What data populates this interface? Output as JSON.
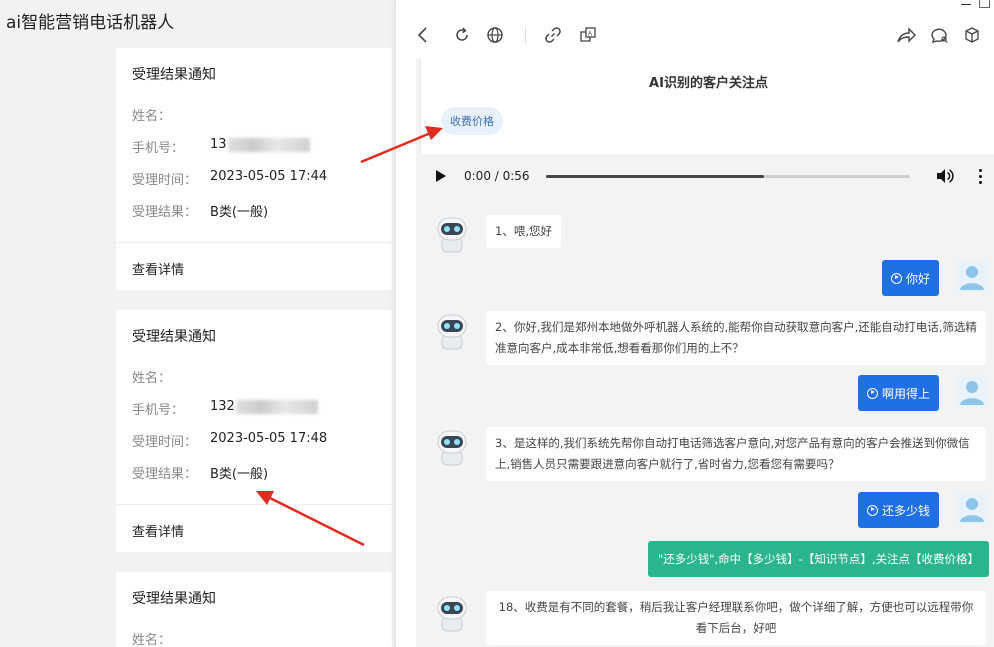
{
  "app": {
    "title": "ai智能营销电话机器人"
  },
  "cards": [
    {
      "title": "受理结果通知",
      "name_label": "姓名：",
      "name_value": "",
      "phone_label": "手机号：",
      "phone_value": "13",
      "time_label": "受理时间：",
      "time_value": "2023-05-05 17:44",
      "result_label": "受理结果：",
      "result_value": "B类(一般)",
      "detail": "查看详情"
    },
    {
      "title": "受理结果通知",
      "name_label": "姓名：",
      "name_value": "",
      "phone_label": "手机号：",
      "phone_value": "132",
      "time_label": "受理时间：",
      "time_value": "2023-05-05 17:48",
      "result_label": "受理结果：",
      "result_value": "B类(一般)",
      "detail": "查看详情"
    },
    {
      "title": "受理结果通知",
      "name_label": "姓名："
    }
  ],
  "panel": {
    "focus_title": "AI识别的客户关注点",
    "tags": [
      "收费价格"
    ],
    "audio": {
      "time": "0:00 / 0:56",
      "progress": 0.6
    },
    "messages": [
      {
        "role": "bot",
        "text": "1、喂,您好"
      },
      {
        "role": "user",
        "text": "你好"
      },
      {
        "role": "bot",
        "text": "2、你好,我们是郑州本地做外呼机器人系统的,能帮你自动获取意向客户,还能自动打电话,筛选精准意向客户,成本非常低,想看看那你们用的上不？"
      },
      {
        "role": "user",
        "text": "啊用得上"
      },
      {
        "role": "bot",
        "text": "3、是这样的,我们系统先帮你自动打电话筛选客户意向,对您产品有意向的客户会推送到你微信上,销售人员只需要跟进意向客户就行了,省时省力,您看您有需要吗？"
      },
      {
        "role": "user",
        "text": "还多少钱"
      },
      {
        "role": "hit",
        "text": "\"还多少钱\",命中【多少钱】-【知识节点】,关注点【收费价格】"
      },
      {
        "role": "bot",
        "text": "18、收费是有不同的套餐，稍后我让客户经理联系你吧，做个详细了解，方便也可以远程带你看下后台，好吧"
      }
    ]
  },
  "colors": {
    "accent_blue": "#1f6fe5",
    "hit_green": "#2bb58f",
    "tag_bg": "#e8f1fb",
    "arrow_red": "#e02b20"
  }
}
